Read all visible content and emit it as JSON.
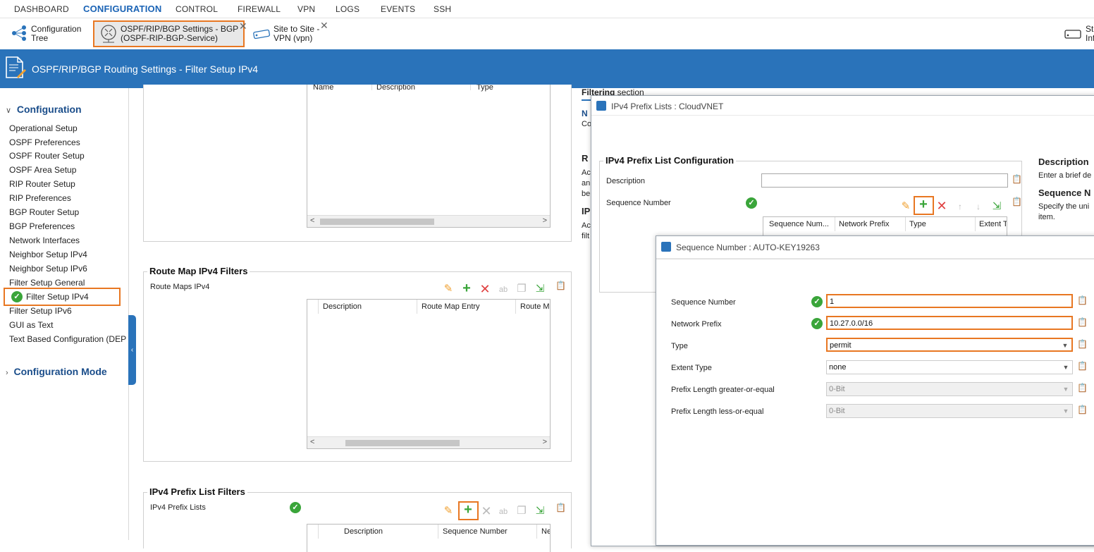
{
  "nav": {
    "items": [
      "DASHBOARD",
      "CONFIGURATION",
      "CONTROL",
      "FIREWALL",
      "VPN",
      "LOGS",
      "EVENTS",
      "SSH"
    ],
    "active": "CONFIGURATION"
  },
  "tabs": {
    "config_tree_1": "Configuration",
    "config_tree_2": "Tree",
    "bgp_1": "OSPF/RIP/BGP Settings - BGP",
    "bgp_2": "(OSPF-RIP-BGP-Service)",
    "vpn_1": "Site to Site -",
    "vpn_2": "VPN (vpn)",
    "right_1": "Sta",
    "right_2": "Inf"
  },
  "header": {
    "title": "OSPF/RIP/BGP Routing Settings - Filter Setup IPv4"
  },
  "sidebar": {
    "section1": "Configuration",
    "items": [
      "Operational Setup",
      "OSPF Preferences",
      "OSPF Router Setup",
      "OSPF Area Setup",
      "RIP Router Setup",
      "RIP Preferences",
      "BGP Router Setup",
      "BGP Preferences",
      "Network Interfaces",
      "Neighbor Setup IPv4",
      "Neighbor Setup IPv6",
      "Filter Setup General",
      "Filter Setup IPv4",
      "Filter Setup IPv6",
      "GUI as Text",
      "Text Based Configuration (DEP"
    ],
    "selected_index": 12,
    "section2": "Configuration Mode"
  },
  "top_grid": {
    "columns": [
      "Name",
      "Description",
      "Type"
    ]
  },
  "route_map": {
    "title": "Route Map IPv4 Filters",
    "label": "Route Maps IPv4",
    "columns": [
      "Description",
      "Route Map Entry",
      "Route M"
    ]
  },
  "prefix_filters": {
    "title": "IPv4 Prefix List Filters",
    "label": "IPv4 Prefix Lists",
    "columns": [
      "Description",
      "Sequence Number",
      "Ne"
    ]
  },
  "right_text": {
    "filtering_bold": "Filtering",
    "filtering_rest": " section",
    "n": "N",
    "co": "Co",
    "r": "R",
    "ac1": "Ac",
    "an": "an",
    "be": "be",
    "ip": "IP",
    "ac2": "Ac",
    "filt": "filt"
  },
  "prefix_window": {
    "title": "IPv4 Prefix Lists : CloudVNET",
    "section": "IPv4 Prefix List Configuration",
    "description_label": "Description",
    "description_value": "",
    "seq_label": "Sequence Number",
    "columns": [
      "Sequence Num...",
      "Network Prefix",
      "Type",
      "Extent T"
    ],
    "help_desc_title": "Description",
    "help_desc_text": "Enter a brief de",
    "help_seq_title": "Sequence N",
    "help_seq_text1": "Specify the uni",
    "help_seq_text2": "item."
  },
  "seq_window": {
    "title": "Sequence Number : AUTO-KEY19263",
    "fields": [
      {
        "label": "Sequence Number",
        "value": "1"
      },
      {
        "label": "Network Prefix",
        "value": "10.27.0.0/16"
      },
      {
        "label": "Type",
        "value": "permit"
      },
      {
        "label": "Extent Type",
        "value": "none"
      },
      {
        "label": "Prefix Length greater-or-equal",
        "value": "0-Bit"
      },
      {
        "label": "Prefix Length less-or-equal",
        "value": "0-Bit"
      }
    ]
  },
  "colors": {
    "accent": "#2a73ba",
    "highlight": "#e87722",
    "ok": "#3aa53a"
  }
}
